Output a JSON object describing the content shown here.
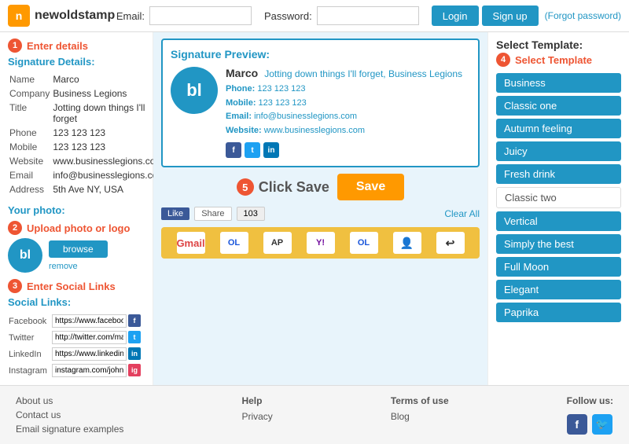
{
  "header": {
    "logo_text": "newoldstamp",
    "logo_initial": "n",
    "email_label": "Email:",
    "password_label": "Password:",
    "email_value": "",
    "password_value": "",
    "login_label": "Login",
    "signup_label": "Sign up",
    "forgot_label": "(Forgot password)"
  },
  "left": {
    "step1_number": "1",
    "step1_text": "Enter details",
    "section_title": "Signature Details:",
    "fields": [
      {
        "label": "Name",
        "value": "Marco"
      },
      {
        "label": "Company",
        "value": "Business Legions"
      },
      {
        "label": "Title",
        "value": "Jotting down things I'll forget"
      },
      {
        "label": "Phone",
        "value": "123 123 123"
      },
      {
        "label": "Mobile",
        "value": "123 123 123"
      },
      {
        "label": "Website",
        "value": "www.businesslegions.com"
      },
      {
        "label": "Email",
        "value": "info@businesslegions.com"
      },
      {
        "label": "Address",
        "value": "5th Ave NY, USA"
      }
    ],
    "photo_section_title": "Your photo:",
    "step2_number": "2",
    "step2_text": "Upload photo or logo",
    "logo_initials": "bl",
    "remove_label": "remove",
    "browse_label": "browse",
    "step3_number": "3",
    "step3_text": "Enter Social Links",
    "social_title": "Social Links:",
    "social_fields": [
      {
        "label": "Facebook",
        "value": "https://www.facebook.com/",
        "icon": "f",
        "color": "#3b5998"
      },
      {
        "label": "Twitter",
        "value": "http://twitter.com/marco_tr",
        "icon": "t",
        "color": "#1da1f2"
      },
      {
        "label": "LinkedIn",
        "value": "https://www.linkedin.com/ir",
        "icon": "in",
        "color": "#0077b5"
      },
      {
        "label": "Instagram",
        "value": "instagram.com/johndoe",
        "icon": "ig",
        "color": "#e4405f"
      }
    ]
  },
  "center": {
    "preview_title": "Signature Preview:",
    "preview": {
      "name": "Marco",
      "tagline": "Jotting down things I'll forget, Business Legions",
      "logo_initials": "bl",
      "phone_label": "Phone:",
      "phone": "123 123 123",
      "mobile_label": "Mobile:",
      "mobile": "123 123 123",
      "email_label": "Email:",
      "email": "info@businesslegions.com",
      "website_label": "Website:",
      "website": "www.businesslegions.com"
    },
    "step5_number": "5",
    "click_save_label": "Click Save",
    "save_btn_label": "Save",
    "like_label": "Like",
    "share_label": "Share",
    "like_count": "103",
    "clear_all_label": "Clear All",
    "install_bar_icons": [
      "Gmail",
      "OL",
      "AP",
      "Y!",
      "OL2",
      "👤",
      "↩"
    ]
  },
  "right": {
    "select_title": "Select Template:",
    "step4_number": "4",
    "step4_text": "Select Template",
    "templates": [
      {
        "label": "Business",
        "active": true
      },
      {
        "label": "Classic one",
        "active": true
      },
      {
        "label": "Autumn feeling",
        "active": true
      },
      {
        "label": "Juicy",
        "active": true
      },
      {
        "label": "Fresh drink",
        "active": true
      },
      {
        "label": "Classic two",
        "active": false
      },
      {
        "label": "Vertical",
        "active": true
      },
      {
        "label": "Simply the best",
        "active": true
      },
      {
        "label": "Full Moon",
        "active": true
      },
      {
        "label": "Elegant",
        "active": true
      },
      {
        "label": "Paprika",
        "active": true
      }
    ]
  },
  "footer": {
    "col1": [
      {
        "label": "About us"
      },
      {
        "label": "Contact us"
      },
      {
        "label": "Email signature examples"
      }
    ],
    "col2_title": "Help",
    "col2": [
      {
        "label": "Privacy"
      }
    ],
    "col3_title": "Terms of use",
    "col3": [
      {
        "label": "Blog"
      }
    ],
    "follow_title": "Follow us:"
  }
}
